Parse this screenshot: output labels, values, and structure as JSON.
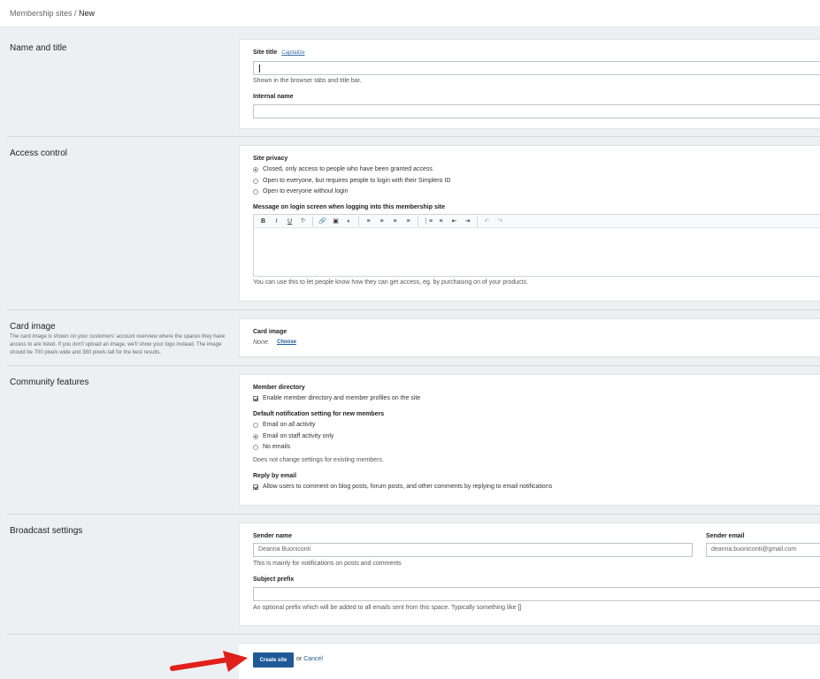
{
  "breadcrumb": {
    "parent": "Membership sites",
    "separator": " / ",
    "current": "New"
  },
  "name_title": {
    "section_title": "Name and title",
    "site_title_label": "Site title",
    "capitalize_link": "Capitalize",
    "site_title_value": "",
    "site_title_hint": "Shown in the browser tabs and title bar.",
    "internal_name_label": "Internal name",
    "internal_name_value": ""
  },
  "access": {
    "section_title": "Access control",
    "privacy_label": "Site privacy",
    "options": [
      {
        "label": "Closed, only access to people who have been granted access",
        "selected": true
      },
      {
        "label": "Open to everyone, but requires people to login with their Simplero ID",
        "selected": false
      },
      {
        "label": "Open to everyone without login",
        "selected": false
      }
    ],
    "message_label": "Message on login screen when logging into this membership site",
    "toolbar_icons": [
      "bold-icon",
      "italic-icon",
      "underline-icon",
      "text-size-icon",
      "link-icon",
      "image-icon",
      "color-icon",
      "align-left-icon",
      "align-center-icon",
      "align-right-icon",
      "align-justify-icon",
      "bulleted-list-icon",
      "numbered-list-icon",
      "outdent-icon",
      "indent-icon",
      "undo-icon",
      "redo-icon"
    ],
    "editor_hint": "You can use this to let people know how they can get access, eg. by purchasing on of your products."
  },
  "card_image": {
    "section_title": "Card image",
    "section_desc": "The card image is shown on your customers' account overview where the spaces they have access to are listed. If you don't upload an image, we'll show your logo instead. The image should be 700 pixels wide and 380 pixels tall for the best results.",
    "label": "Card image",
    "value": "None.",
    "choose_link": "Choose"
  },
  "community": {
    "section_title": "Community features",
    "directory_label": "Member directory",
    "directory_option": "Enable member directory and member profiles on the site",
    "directory_checked": true,
    "notif_label": "Default notification setting for new members",
    "notif_options": [
      {
        "label": "Email on all activity",
        "selected": false
      },
      {
        "label": "Email on staff activity only",
        "selected": true
      },
      {
        "label": "No emails",
        "selected": false
      }
    ],
    "notif_hint": "Does not change settings for existing members.",
    "reply_label": "Reply by email",
    "reply_option": "Allow users to comment on blog posts, forum posts, and other comments by replying to email notifications",
    "reply_checked": true
  },
  "broadcast": {
    "section_title": "Broadcast settings",
    "sender_name_label": "Sender name",
    "sender_name_value": "Deanna Buoniconti",
    "sender_email_label": "Sender email",
    "sender_email_value": "deanna.buoniconti@gmail.com",
    "sender_hint": "This is mainly for notifications on posts and comments",
    "subject_label": "Subject prefix",
    "subject_value": "",
    "subject_hint": "An optional prefix which will be added to all emails sent from this space. Typically something like []"
  },
  "actions": {
    "create_label": "Create site",
    "or_text": "or",
    "cancel_label": "Cancel"
  },
  "colors": {
    "primary": "#1f5a98",
    "arrow": "#e0201b",
    "background": "#edf0f3"
  }
}
